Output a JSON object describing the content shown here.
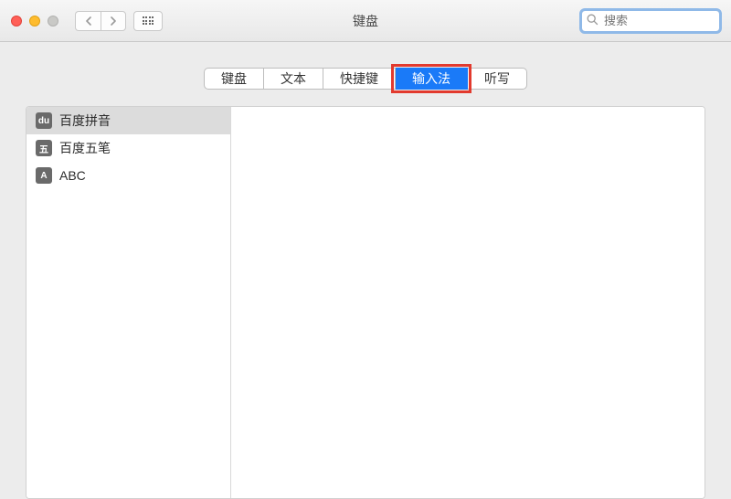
{
  "window": {
    "title": "键盘"
  },
  "search": {
    "placeholder": "搜索"
  },
  "tabs": [
    {
      "label": "键盘",
      "active": false
    },
    {
      "label": "文本",
      "active": false
    },
    {
      "label": "快捷键",
      "active": false
    },
    {
      "label": "输入法",
      "active": true
    },
    {
      "label": "听写",
      "active": false
    }
  ],
  "input_sources": [
    {
      "icon": "du",
      "icon_text": "du",
      "label": "百度拼音",
      "selected": true
    },
    {
      "icon": "wu",
      "icon_text": "五",
      "label": "百度五笔",
      "selected": false
    },
    {
      "icon": "abc",
      "icon_text": "A",
      "label": "ABC",
      "selected": false
    }
  ]
}
